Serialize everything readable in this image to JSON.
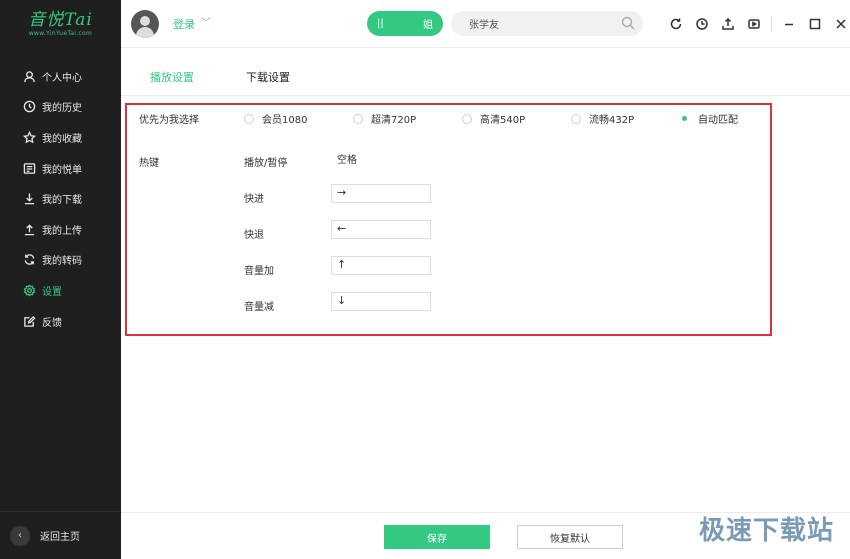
{
  "app": {
    "logo_text": "音悦Tai",
    "logo_sub": "www.YinYueTai.com"
  },
  "sidebar": {
    "items": [
      {
        "label": "个人中心",
        "icon": "user-icon"
      },
      {
        "label": "我的历史",
        "icon": "clock-icon"
      },
      {
        "label": "我的收藏",
        "icon": "star-icon"
      },
      {
        "label": "我的悦单",
        "icon": "playlist-icon"
      },
      {
        "label": "我的下载",
        "icon": "download-icon"
      },
      {
        "label": "我的上传",
        "icon": "upload-icon"
      },
      {
        "label": "我的转码",
        "icon": "convert-icon"
      },
      {
        "label": "设置",
        "icon": "gear-icon",
        "active": true
      },
      {
        "label": "反馈",
        "icon": "feedback-icon"
      }
    ],
    "back_label": "返回主页"
  },
  "header": {
    "login_label": "登录",
    "toggle_left": "||",
    "toggle_right": "姐",
    "search_value": "张学友"
  },
  "tabs": [
    {
      "label": "播放设置",
      "active": true
    },
    {
      "label": "下载设置",
      "active": false
    }
  ],
  "settings": {
    "priority_label": "优先为我选择",
    "quality_options": [
      {
        "label": "会员1080",
        "selected": false
      },
      {
        "label": "超清720P",
        "selected": false
      },
      {
        "label": "高清540P",
        "selected": false
      },
      {
        "label": "流畅432P",
        "selected": false
      },
      {
        "label": "自动匹配",
        "selected": true
      }
    ],
    "hotkey_label": "热键",
    "hotkeys": [
      {
        "name": "播放/暂停",
        "key": "空格"
      },
      {
        "name": "快进",
        "key": "→"
      },
      {
        "name": "快退",
        "key": "←"
      },
      {
        "name": "音量加",
        "key": "↑"
      },
      {
        "name": "音量减",
        "key": "↓"
      }
    ]
  },
  "footer": {
    "save_label": "保存",
    "reset_label": "恢复默认"
  },
  "watermark": "极速下载站",
  "colors": {
    "accent": "#34c983",
    "sidebar_bg": "#1f1f1f",
    "highlight_box": "#d9343a"
  }
}
